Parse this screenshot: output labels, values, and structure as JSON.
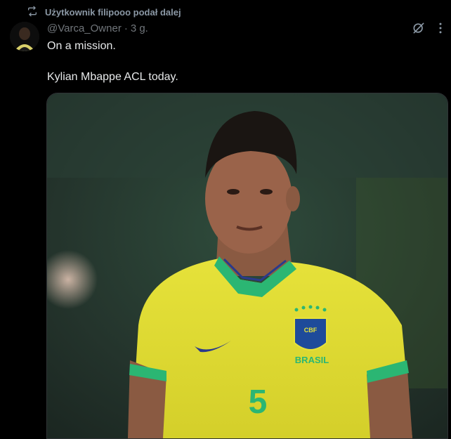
{
  "retweet": {
    "label": "Użytkownik filipooo podał dalej",
    "icon": "retweet-icon"
  },
  "tweet": {
    "handle": "@Varca_Owner",
    "separator": "·",
    "time": "3 g.",
    "text_lines": [
      "On a mission.",
      "Kylian Mbappe ACL today."
    ],
    "icons": {
      "grok": "grok-icon",
      "more": "more-icon"
    }
  },
  "media": {
    "alt": "Brazil player wearing yellow jersey number 5",
    "jersey_badge": "CBF",
    "jersey_text": "BRASIL",
    "jersey_number": "5"
  },
  "colors": {
    "background": "#000000",
    "text": "#e7e9ea",
    "muted": "#71767b",
    "jersey_yellow": "#e8e03a",
    "jersey_green": "#2bb673"
  }
}
